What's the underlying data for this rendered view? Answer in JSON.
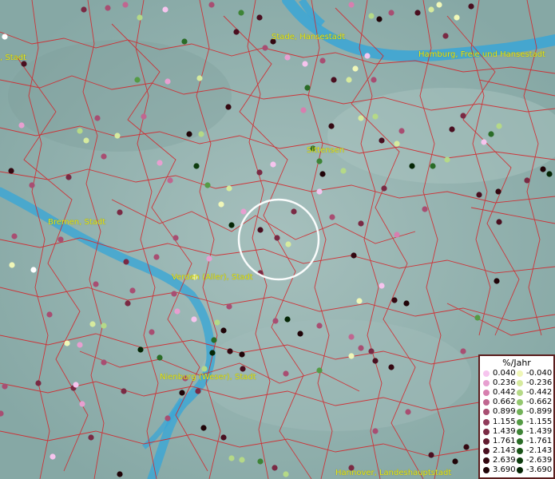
{
  "map": {
    "cities": [
      {
        "name": "Stade, Hansestadt"
      },
      {
        "name": "Hamburg, Freie und Hansestadt"
      },
      {
        "name": ", Stadt"
      },
      {
        "name": "Sittensen"
      },
      {
        "name": "Bremen, Stadt"
      },
      {
        "name": "Verden (Aller), Stadt"
      },
      {
        "name": "Nienburg (Weser), Stadt"
      },
      {
        "name": "Hannover, Landeshauptstadt"
      }
    ],
    "colors": {
      "background": "#8fb0ad",
      "river": "#3aa6d6",
      "boundary": "#d2282d",
      "label": "#e6e61e",
      "focus_circle": "#ffffff"
    }
  },
  "legend": {
    "title": "%/Jahr",
    "positive": [
      {
        "value": "0.040",
        "color": "#f6c4ee"
      },
      {
        "value": "0.236",
        "color": "#e79fd0"
      },
      {
        "value": "0.442",
        "color": "#d77faf"
      },
      {
        "value": "0.662",
        "color": "#c06690"
      },
      {
        "value": "0.899",
        "color": "#a84e72"
      },
      {
        "value": "1.155",
        "color": "#903a5a"
      },
      {
        "value": "1.439",
        "color": "#7a2a44"
      },
      {
        "value": "1.761",
        "color": "#621c30"
      },
      {
        "value": "2.143",
        "color": "#4a0f20"
      },
      {
        "value": "2.639",
        "color": "#340811"
      },
      {
        "value": "3.690",
        "color": "#200408"
      }
    ],
    "negative": [
      {
        "value": "-0.040",
        "color": "#f0f7b8"
      },
      {
        "value": "-0.236",
        "color": "#d6ea9e"
      },
      {
        "value": "-0.442",
        "color": "#b5d987"
      },
      {
        "value": "-0.662",
        "color": "#94c76f"
      },
      {
        "value": "-0.899",
        "color": "#73b259"
      },
      {
        "value": "-1.155",
        "color": "#559b45"
      },
      {
        "value": "-1.439",
        "color": "#3e8436"
      },
      {
        "value": "-1.761",
        "color": "#2a6c27"
      },
      {
        "value": "-2.143",
        "color": "#1a5419"
      },
      {
        "value": "-2.639",
        "color": "#0e3d0f"
      },
      {
        "value": "-3.690",
        "color": "#052605"
      }
    ]
  }
}
